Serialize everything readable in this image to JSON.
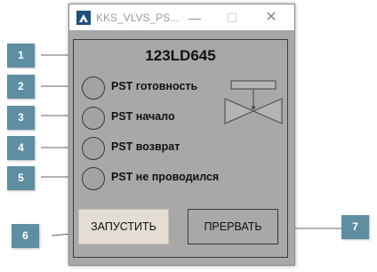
{
  "window": {
    "title": "KKS_VLVS_PS...",
    "minimize_glyph": "—",
    "maximize_glyph": "☐",
    "close_glyph": "✕"
  },
  "device": {
    "id": "123LD645"
  },
  "statuses": [
    {
      "label": "PST готовность"
    },
    {
      "label": "PST начало"
    },
    {
      "label": "PST возврат"
    },
    {
      "label": "PST не проводился"
    }
  ],
  "buttons": {
    "start": "ЗАПУСТИТЬ",
    "abort": "ПРЕРВАТЬ"
  },
  "callouts": [
    "1",
    "2",
    "3",
    "4",
    "5",
    "6",
    "7"
  ],
  "colors": {
    "callout": "#5f8ea2",
    "panel": "#a8a8a8",
    "lamp": "#a3a3a3"
  },
  "icons": {
    "app": "app-logo-icon",
    "valve": "valve-icon"
  }
}
